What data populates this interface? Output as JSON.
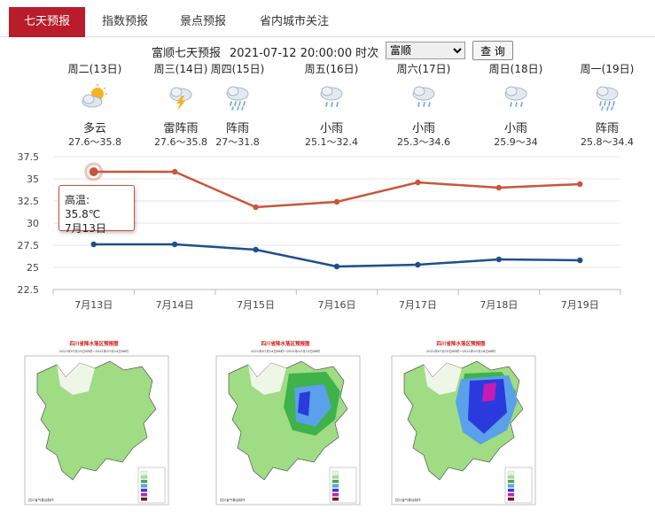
{
  "tabs": [
    "七天预报",
    "指数预报",
    "景点预报",
    "省内城市关注"
  ],
  "query": {
    "city_name": "富顺",
    "title_suffix": "七天预报",
    "issue_time": "2021-07-12 20:00:00",
    "time_label": "时次",
    "selected_city": "富顺",
    "button_label": "查 询"
  },
  "days": [
    {
      "label": "周二(13日)",
      "weather": "多云",
      "range": "27.6～35.8",
      "icon": "partly-cloudy-icon"
    },
    {
      "label": "周三(14日)",
      "weather": "雷阵雨",
      "range": "27.6～35.8",
      "icon": "thunderstorm-icon"
    },
    {
      "label": "周四(15日)",
      "weather": "阵雨",
      "range": "27～31.8",
      "icon": "shower-icon"
    },
    {
      "label": "周五(16日)",
      "weather": "小雨",
      "range": "25.1～32.4",
      "icon": "light-rain-icon"
    },
    {
      "label": "周六(17日)",
      "weather": "小雨",
      "range": "25.3～34.6",
      "icon": "light-rain-icon"
    },
    {
      "label": "周日(18日)",
      "weather": "小雨",
      "range": "25.9～34",
      "icon": "light-rain-icon"
    },
    {
      "label": "周一(19日)",
      "weather": "阵雨",
      "range": "25.8～34.4",
      "icon": "shower-icon"
    }
  ],
  "chart_data": {
    "type": "line",
    "categories": [
      "7月13日",
      "7月14日",
      "7月15日",
      "7月16日",
      "7月17日",
      "7月18日",
      "7月19日"
    ],
    "series": [
      {
        "name": "高温",
        "values": [
          35.8,
          35.8,
          31.8,
          32.4,
          34.6,
          34,
          34.4
        ],
        "color": "#c9553b"
      },
      {
        "values": [
          27.6,
          27.6,
          27,
          25.1,
          25.3,
          25.9,
          25.8
        ],
        "color": "#1f4e8c"
      }
    ],
    "yticks": [
      "37.5",
      "35",
      "32.5",
      "30",
      "27.5",
      "25",
      "22.5"
    ],
    "ylim": [
      22.5,
      37.5
    ],
    "grid": true
  },
  "tooltip": {
    "line1": "高温: 35.8℃",
    "line2": "7月13日"
  },
  "maps": [
    {
      "title": "四川省降水落区预报图",
      "subtitle": "2021年07月13日08时～2021年07月14日08时",
      "footer": "四川省气象台制作",
      "level": 1
    },
    {
      "title": "四川省降水落区预报图",
      "subtitle": "2021年07月14日08时～2021年07月15日08时",
      "footer": "四川省气象台制作",
      "level": 2
    },
    {
      "title": "四川省降水落区预报图",
      "subtitle": "2021年07月15日08时～2021年07月16日08时",
      "footer": "四川省气象台制作",
      "level": 3
    }
  ],
  "colors": {
    "accent": "#b91c2a",
    "high": "#c9553b",
    "low": "#1f4e8c"
  }
}
